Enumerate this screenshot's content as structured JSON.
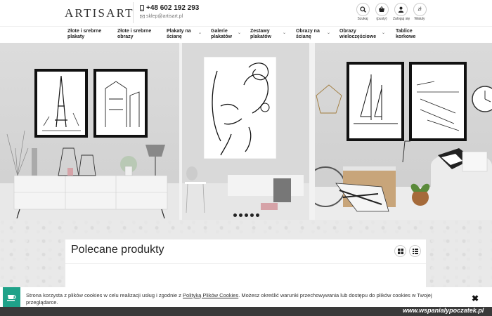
{
  "header": {
    "logo": "ARTISART",
    "phone": "+48 602 192 293",
    "email": "sklep@artisart.pl",
    "icons": [
      {
        "name": "search-icon",
        "label": "Szukaj"
      },
      {
        "name": "cart-icon",
        "label": "(pusty)"
      },
      {
        "name": "user-icon",
        "label": "Zaloguj się"
      },
      {
        "name": "currency-icon",
        "label": "Waluty",
        "glyph": "zł"
      }
    ]
  },
  "nav": {
    "items": [
      {
        "line1": "Złote i srebrne",
        "line2": "plakaty"
      },
      {
        "line1": "Złote i srebrne",
        "line2": "obrazy"
      },
      {
        "line1": "Plakaty na",
        "line2": "ścianę"
      },
      {
        "line1": "Galerie",
        "line2": "plakatów"
      },
      {
        "line1": "Zestawy",
        "line2": "plakatów"
      },
      {
        "line1": "Obrazy na",
        "line2": "ścianę"
      },
      {
        "line1": "Obrazy",
        "line2": "wieloczęściowe"
      },
      {
        "line1": "Tablice",
        "line2": "korkowe"
      }
    ]
  },
  "featured": {
    "title": "Polecane produkty"
  },
  "cookie": {
    "text_before": "Strona korzysta z plików cookies w celu realizacji usług i zgodnie z ",
    "link": "Polityką Plików Cookies",
    "text_after": ". Możesz określić warunki przechowywania lub dostępu do plików cookies w Twojej przeglądarce."
  },
  "watermark": "www.wspanialypoczatek.pl",
  "colors": {
    "accent": "#1fa289"
  }
}
